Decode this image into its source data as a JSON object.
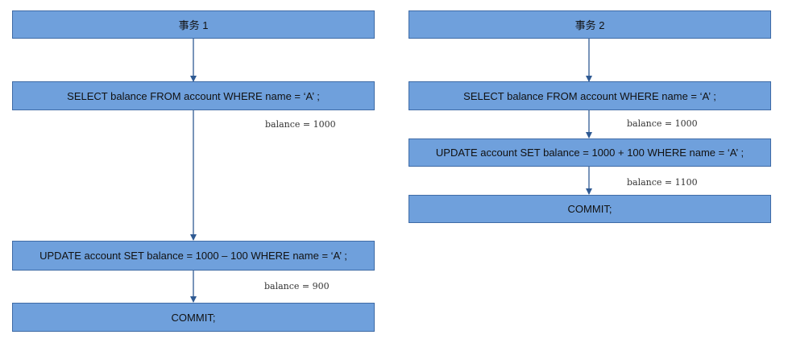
{
  "transaction1": {
    "title": "事务 1",
    "select_stmt": "SELECT balance FROM account WHERE name =  ‘A’ ;",
    "select_result": "balance = 1000",
    "update_stmt": "UPDATE account SET balance = 1000 – 100 WHERE name =  ‘A’ ;",
    "update_result": "balance = 900",
    "commit_stmt": "COMMIT;"
  },
  "transaction2": {
    "title": "事务 2",
    "select_stmt": "SELECT balance FROM account WHERE name =  ‘A’ ;",
    "select_result": "balance = 1000",
    "update_stmt": "UPDATE account SET balance = 1000 + 100 WHERE name =  ‘A’ ;",
    "update_result": "balance = 1100",
    "commit_stmt": "COMMIT;"
  },
  "colors": {
    "box_fill": "#6fa0dc",
    "box_border": "#3f6ba6",
    "arrow": "#2f5a93"
  }
}
